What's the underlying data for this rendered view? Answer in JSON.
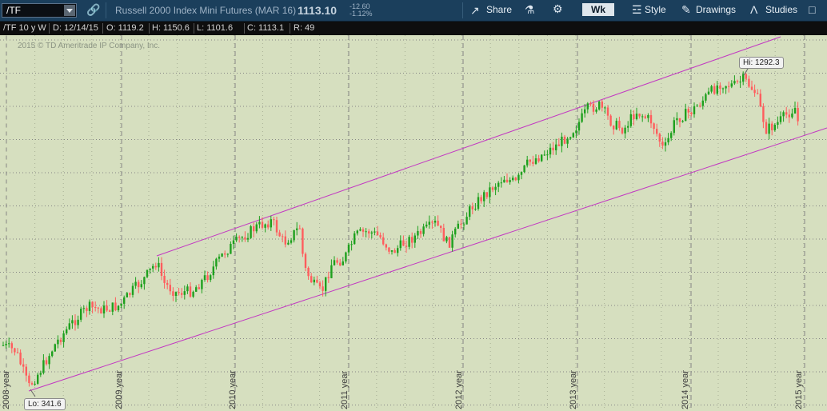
{
  "toolbar": {
    "symbol": "/TF",
    "title": "Russell 2000 Index Mini Futures (MAR 16)",
    "last_price": "1113.10",
    "net_change": "-12.60",
    "pct_change": "-1.12%",
    "share_label": "Share",
    "aggregation": "Wk",
    "style_label": "Style",
    "drawings_label": "Drawings",
    "studies_label": "Studies"
  },
  "infobar": {
    "period": "/TF 10 y W",
    "date": "D: 12/14/15",
    "open": "O: 1119.2",
    "high": "H: 1150.6",
    "low": "L: 1101.6",
    "close": "C: 1113.1",
    "range": "R: 49"
  },
  "chart_data": {
    "type": "candlestick",
    "copyright": "2015 © TD Ameritrade IP Company, Inc.",
    "period_markers": [
      "2008 year",
      "2009 year",
      "2010 year",
      "2011 year",
      "2012 year",
      "2013 year",
      "2014 year",
      "2015 year"
    ],
    "hi_label": "Hi: 1292.3",
    "lo_label": "Lo: 341.6",
    "high": 1292.3,
    "low": 341.6,
    "trend_channel": "two parallel magenta lines, upward",
    "colors": {
      "up": "#1ea01e",
      "down": "#ff5d5d",
      "channel": "#c238c2",
      "background": "#d6dfbf",
      "grid": "#858585"
    }
  }
}
